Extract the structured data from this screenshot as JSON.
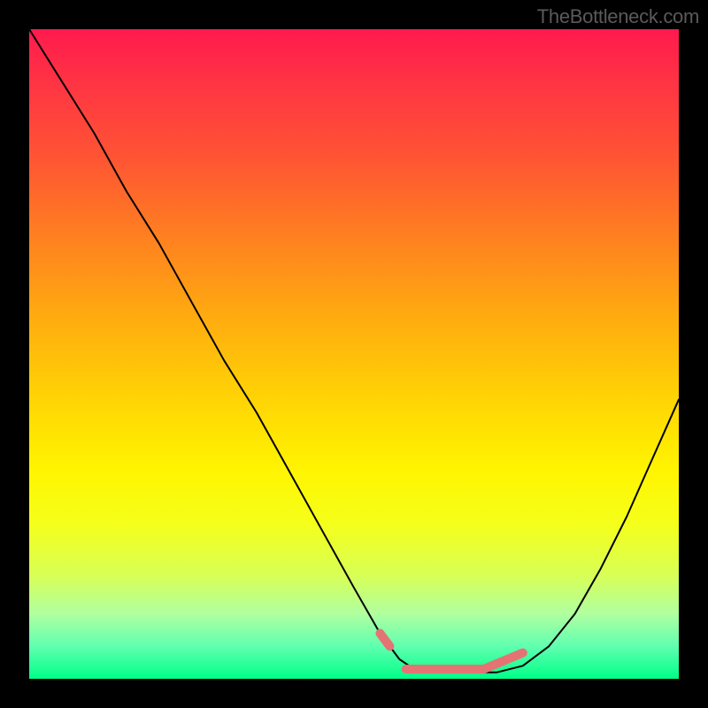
{
  "watermark": "TheBottleneck.com",
  "colors": {
    "curve": "#000000",
    "highlight": "#e57373",
    "gradient_top": "#ff1a4d",
    "gradient_bottom": "#00ff88"
  },
  "chart_data": {
    "type": "line",
    "title": "",
    "xlabel": "",
    "ylabel": "",
    "xlim": [
      0,
      100
    ],
    "ylim": [
      0,
      100
    ],
    "x": [
      0,
      5,
      10,
      15,
      20,
      25,
      30,
      35,
      40,
      45,
      50,
      54,
      57,
      60,
      64,
      68,
      72,
      76,
      80,
      84,
      88,
      92,
      96,
      100
    ],
    "y": [
      100,
      92,
      84,
      75,
      67,
      58,
      49,
      41,
      32,
      23,
      14,
      7,
      3,
      1,
      1,
      1,
      1,
      2,
      5,
      10,
      17,
      25,
      34,
      43
    ],
    "highlight_segments": [
      {
        "x": [
          54,
          55.5
        ],
        "y": [
          7,
          5
        ]
      },
      {
        "x": [
          58,
          70
        ],
        "y": [
          1.5,
          1.5
        ]
      },
      {
        "x": [
          70,
          76
        ],
        "y": [
          1.5,
          4
        ]
      }
    ],
    "annotations": []
  }
}
